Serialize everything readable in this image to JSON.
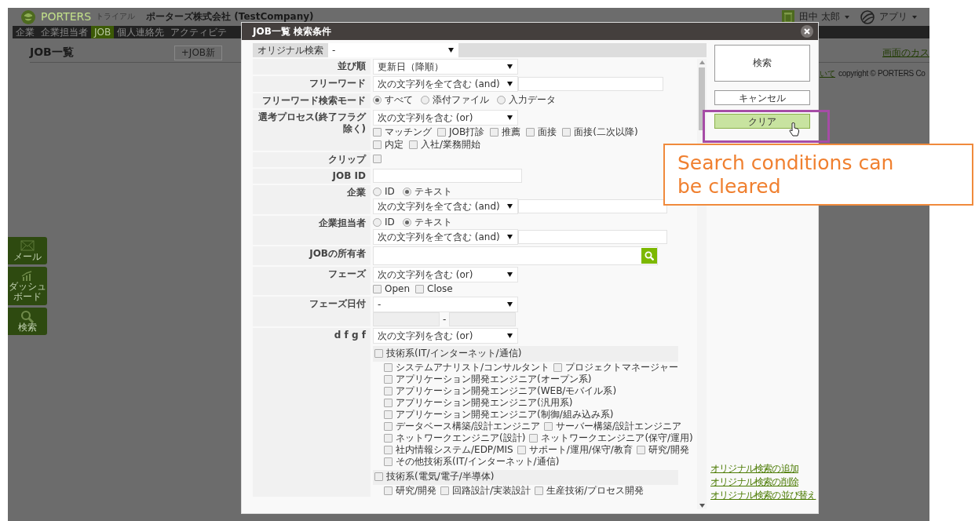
{
  "app": {
    "logo": "PORTERS",
    "edition": "トライアル",
    "company": "ポーターズ株式会社 (TestCompany)",
    "user": "田中 太郎",
    "apps_menu": "アプリ",
    "nav_tabs": [
      {
        "label": "企業",
        "selected": false
      },
      {
        "label": "企業担当者",
        "selected": false
      },
      {
        "label": "JOB",
        "selected": true
      },
      {
        "label": "個人連絡先",
        "selected": false
      },
      {
        "label": "アクティビテ",
        "selected": false
      }
    ],
    "page_title": "JOB一覧",
    "add_button": "+JOB新",
    "customize_link": "画面のカス",
    "about_link": "いて",
    "copyright": "copyright © PORTERS Co",
    "side_buttons": [
      {
        "kind": "mail",
        "label": "メール"
      },
      {
        "kind": "dashboard",
        "label": "ダッシュボード"
      },
      {
        "kind": "search",
        "label": "検索"
      }
    ]
  },
  "modal": {
    "title": "JOB一覧 検索条件",
    "original_search": {
      "label": "オリジナル検索",
      "value": "-"
    },
    "fields": [
      {
        "kind": "select",
        "label": "並び順",
        "value": "更新日（降順）"
      },
      {
        "kind": "select_text",
        "label": "フリーワード",
        "value": "次の文字列を全て含む (and)"
      },
      {
        "kind": "radio",
        "label": "フリーワード検索モード",
        "options": [
          {
            "label": "すべて",
            "selected": true
          },
          {
            "label": "添付ファイル",
            "selected": false
          },
          {
            "label": "入力データ",
            "selected": false
          }
        ]
      },
      {
        "kind": "select_checks",
        "label": "選考プロセス(終了フラグ除く)",
        "value": "次の文字列を含む (or)",
        "options": [
          {
            "label": "マッチング",
            "checked": false
          },
          {
            "label": "JOB打診",
            "checked": false
          },
          {
            "label": "推薦",
            "checked": false
          },
          {
            "label": "面接",
            "checked": false
          },
          {
            "label": "面接(二次以降)",
            "checked": false
          },
          {
            "label": "内定",
            "checked": false
          },
          {
            "label": "入社/業務開始",
            "checked": false
          }
        ]
      },
      {
        "kind": "checkbox",
        "label": "クリップ",
        "checked": false
      },
      {
        "kind": "text",
        "label": "JOB ID"
      },
      {
        "kind": "radio_select",
        "label": "企業",
        "options": [
          {
            "label": "ID",
            "selected": false
          },
          {
            "label": "テキスト",
            "selected": true
          }
        ],
        "value": "次の文字列を全て含む (and)"
      },
      {
        "kind": "radio_select",
        "label": "企業担当者",
        "options": [
          {
            "label": "ID",
            "selected": false
          },
          {
            "label": "テキスト",
            "selected": true
          }
        ],
        "value": "次の文字列を全て含む (and)"
      },
      {
        "kind": "lookup",
        "label": "JOBの所有者"
      },
      {
        "kind": "select_checks",
        "label": "フェーズ",
        "value": "次の文字列を含む (or)",
        "options": [
          {
            "label": "Open",
            "checked": false
          },
          {
            "label": "Close",
            "checked": false
          }
        ]
      },
      {
        "kind": "date_range",
        "label": "フェーズ日付",
        "value": "-",
        "separator": "-"
      },
      {
        "kind": "tree",
        "label": "d f g f",
        "value": "次の文字列を含む (or)",
        "groups": [
          {
            "label": "技術系(IT/インターネット/通信)",
            "checked": false,
            "children": [
              {
                "label": "システムアナリスト/コンサルタント",
                "checked": false
              },
              {
                "label": "プロジェクトマネージャー",
                "checked": false
              },
              {
                "label": "アプリケーション開発エンジニア(オープン系)",
                "checked": false
              },
              {
                "label": "アプリケーション開発エンジニア(WEB/モバイル系)",
                "checked": false
              },
              {
                "label": "アプリケーション開発エンジニア(汎用系)",
                "checked": false
              },
              {
                "label": "アプリケーション開発エンジニア(制御/組み込み系)",
                "checked": false
              },
              {
                "label": "データベース構築/設計エンジニア",
                "checked": false
              },
              {
                "label": "サーバー構築/設計エンジニア",
                "checked": false
              },
              {
                "label": "ネットワークエンジニア(設計)",
                "checked": false
              },
              {
                "label": "ネットワークエンジニア(保守/運用)",
                "checked": false
              },
              {
                "label": "社内情報システム/EDP/MIS",
                "checked": false
              },
              {
                "label": "サポート/運用/保守/教育",
                "checked": false
              },
              {
                "label": "研究/開発",
                "checked": false
              },
              {
                "label": "その他技術系(IT/インターネット/通信)",
                "checked": false
              }
            ]
          },
          {
            "label": "技術系(電気/電子/半導体)",
            "checked": false,
            "children": [
              {
                "label": "研究/開発",
                "checked": false
              },
              {
                "label": "回路設計/実装設計",
                "checked": false
              },
              {
                "label": "生産技術/プロセス開発",
                "checked": false
              }
            ]
          }
        ]
      }
    ],
    "actions": {
      "search": "検索",
      "cancel": "キャンセル",
      "clear": "クリア"
    },
    "links": [
      "オリジナル検索の追加",
      "オリジナル検索の削除",
      "オリジナル検索の並び替え"
    ]
  },
  "callout": {
    "text": "Search conditions can be cleared"
  }
}
